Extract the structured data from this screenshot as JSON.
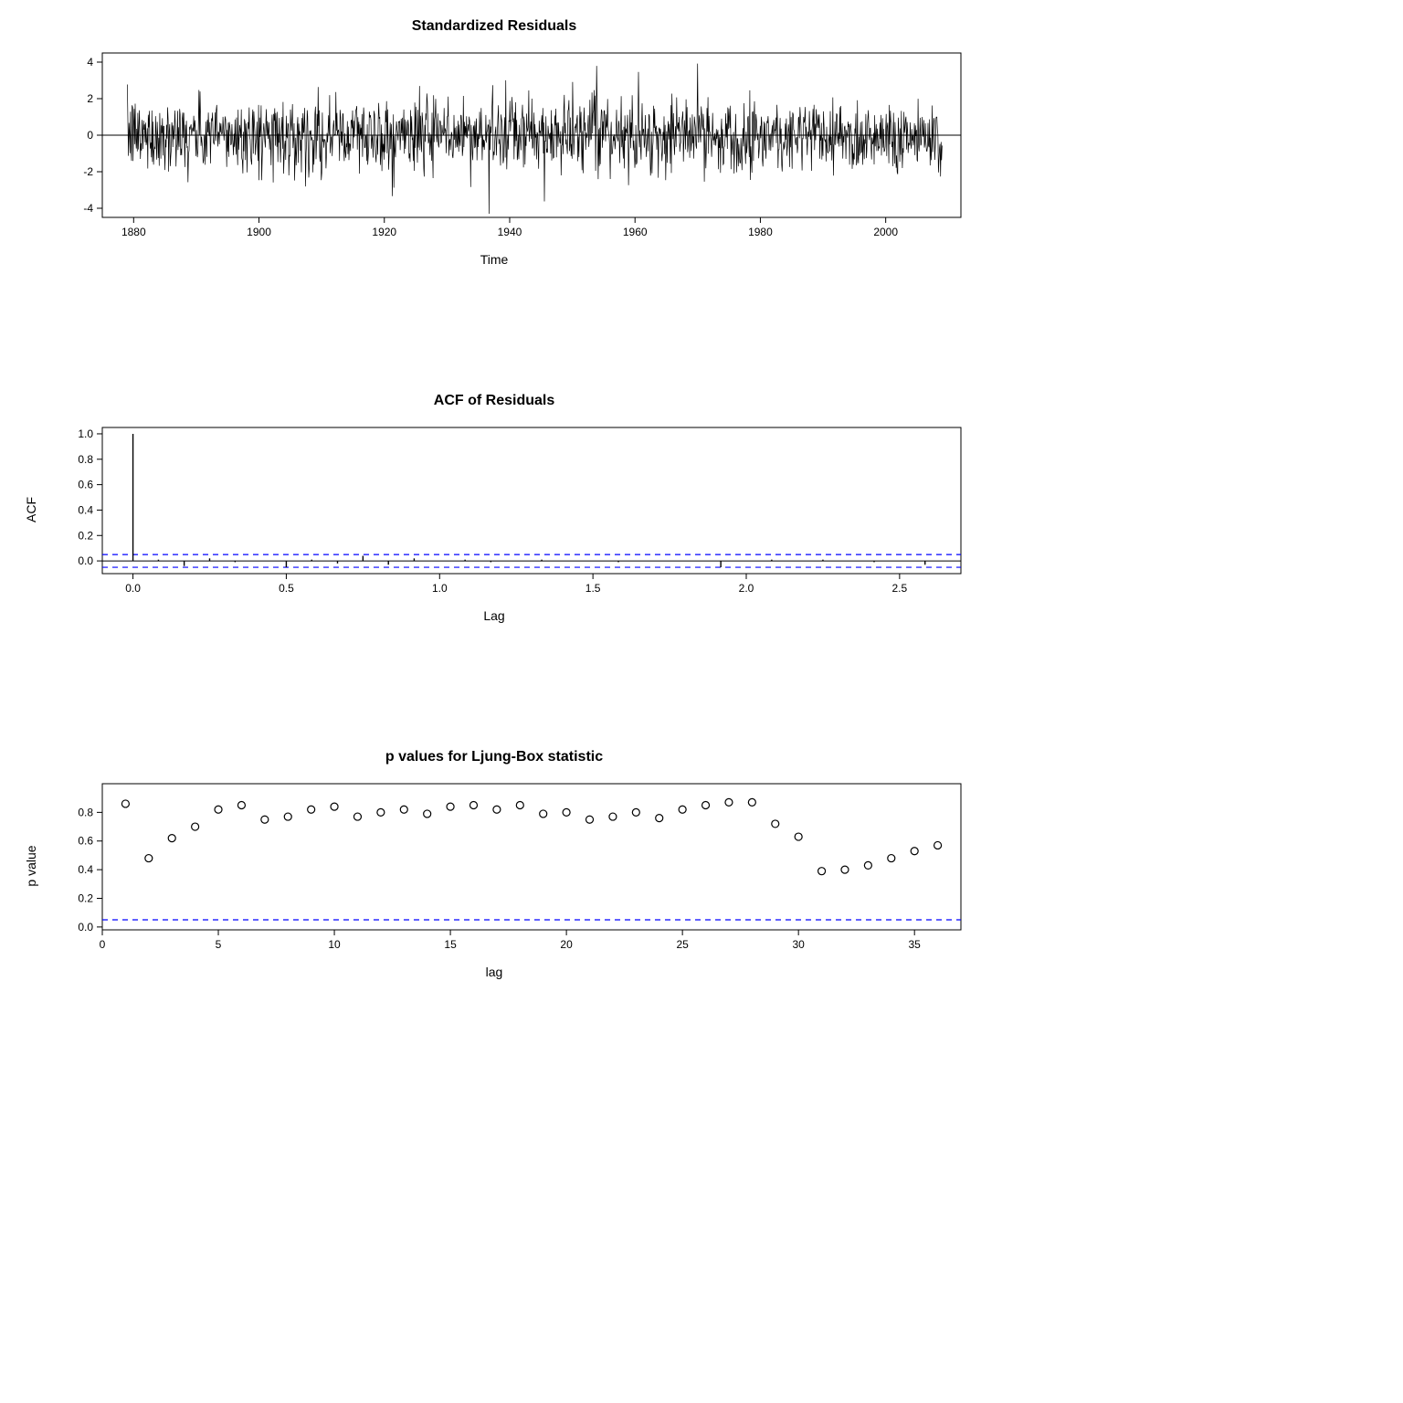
{
  "chart_data": [
    {
      "type": "line",
      "title": "Standardized Residuals",
      "xlabel": "Time",
      "ylabel": "",
      "xlim": [
        1875,
        2012
      ],
      "ylim": [
        -4.5,
        4.5
      ],
      "xticks": [
        1880,
        1900,
        1920,
        1940,
        1960,
        1980,
        2000
      ],
      "yticks": [
        -4,
        -2,
        0,
        2,
        4
      ],
      "_note": "Standardized residuals time series ~1880–2008, centered near zero, roughly white noise, occasional spikes to ±3–4; data not individually readable so approximated."
    },
    {
      "type": "bar",
      "title": "ACF of Residuals",
      "xlabel": "Lag",
      "ylabel": "ACF",
      "xlim": [
        -0.1,
        2.7
      ],
      "ylim": [
        -0.1,
        1.05
      ],
      "xticks": [
        0.0,
        0.5,
        1.0,
        1.5,
        2.0,
        2.5
      ],
      "yticks": [
        0.0,
        0.2,
        0.4,
        0.6,
        0.8,
        1.0
      ],
      "conf_band": [
        -0.05,
        0.05
      ],
      "lags": [
        0.0,
        0.083,
        0.167,
        0.25,
        0.333,
        0.417,
        0.5,
        0.583,
        0.667,
        0.75,
        0.833,
        0.917,
        1.0,
        1.083,
        1.167,
        1.25,
        1.333,
        1.417,
        1.5,
        1.583,
        1.667,
        1.75,
        1.833,
        1.917,
        2.0,
        2.083,
        2.167,
        2.25,
        2.333,
        2.417,
        2.5,
        2.583
      ],
      "acf": [
        1.0,
        0.01,
        -0.04,
        0.02,
        -0.01,
        0.0,
        -0.05,
        0.01,
        -0.02,
        0.04,
        -0.03,
        0.02,
        0.0,
        0.01,
        -0.01,
        0.0,
        0.01,
        0.0,
        0.0,
        -0.01,
        0.0,
        0.0,
        0.0,
        -0.05,
        0.0,
        0.01,
        0.0,
        0.01,
        0.0,
        -0.01,
        0.0,
        -0.03
      ]
    },
    {
      "type": "scatter",
      "title": "p values for Ljung-Box statistic",
      "xlabel": "lag",
      "ylabel": "p value",
      "xlim": [
        0,
        37
      ],
      "ylim": [
        -0.02,
        1.0
      ],
      "xticks": [
        0,
        5,
        10,
        15,
        20,
        25,
        30,
        35
      ],
      "yticks": [
        0.0,
        0.2,
        0.4,
        0.6,
        0.8
      ],
      "hline": 0.05,
      "x": [
        1,
        2,
        3,
        4,
        5,
        6,
        7,
        8,
        9,
        10,
        11,
        12,
        13,
        14,
        15,
        16,
        17,
        18,
        19,
        20,
        21,
        22,
        23,
        24,
        25,
        26,
        27,
        28,
        29,
        30,
        31,
        32,
        33,
        34,
        35,
        36
      ],
      "y": [
        0.86,
        0.48,
        0.62,
        0.7,
        0.82,
        0.85,
        0.75,
        0.77,
        0.82,
        0.84,
        0.77,
        0.8,
        0.82,
        0.79,
        0.84,
        0.85,
        0.82,
        0.85,
        0.79,
        0.8,
        0.75,
        0.77,
        0.8,
        0.76,
        0.82,
        0.85,
        0.87,
        0.87,
        0.72,
        0.63,
        0.39,
        0.4,
        0.43,
        0.48,
        0.53,
        0.57
      ]
    }
  ]
}
